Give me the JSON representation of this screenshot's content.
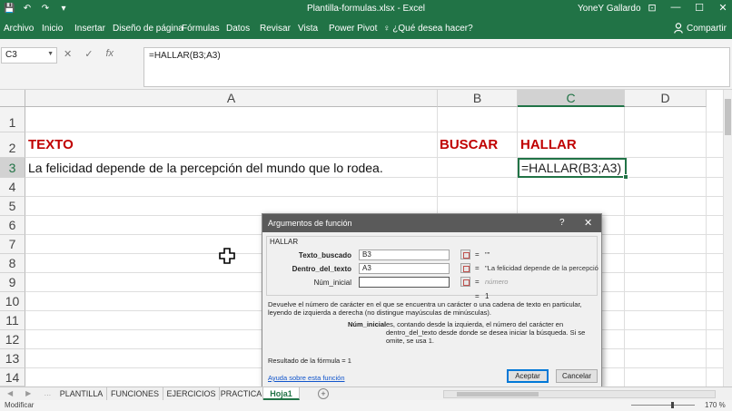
{
  "titlebar": {
    "qat": [
      "💾",
      "↶",
      "↷",
      "▾"
    ],
    "title": "Plantilla-formulas.xlsx  -  Excel",
    "user": "YoneY Gallardo",
    "window_buttons": [
      "⊡",
      "—",
      "☐",
      "✕"
    ]
  },
  "ribbon": {
    "tabs": [
      "Archivo",
      "Inicio",
      "Insertar",
      "Diseño de página",
      "Fórmulas",
      "Datos",
      "Revisar",
      "Vista",
      "Power Pivot"
    ],
    "tell_me": "♀ ¿Qué desea hacer?",
    "share": "Compartir"
  },
  "formula_bar": {
    "name_box": "C3",
    "cancel_icon": "✕",
    "enter_icon": "✓",
    "fx_icon": "fx",
    "formula": "=HALLAR(B3;A3)"
  },
  "grid": {
    "columns": [
      "A",
      "B",
      "C",
      "D"
    ],
    "rows": [
      "1",
      "2",
      "3",
      "4",
      "5",
      "6",
      "7",
      "8",
      "9",
      "10",
      "11",
      "12",
      "13",
      "14"
    ],
    "selected_column": "C",
    "selected_row": "3",
    "cells": {
      "A2": "TEXTO",
      "B2": "BUSCAR",
      "C2": "HALLAR",
      "A3": "La felicidad depende de la percepción del mundo que lo rodea.",
      "C3": "=HALLAR(B3;A3)"
    },
    "header_color": "#c00000"
  },
  "dialog": {
    "title": "Argumentos de función",
    "help": "?",
    "close": "✕",
    "function_name": "HALLAR",
    "args": [
      {
        "label": "Texto_buscado",
        "value": "B3",
        "eq": "=",
        "result": "\"\""
      },
      {
        "label": "Dentro_del_texto",
        "value": "A3",
        "eq": "=",
        "result": "\"La felicidad depende de la percepció"
      },
      {
        "label": "Núm_inicial",
        "value": "",
        "eq": "=",
        "result": "número"
      }
    ],
    "result_eq": "=",
    "result_val": "1",
    "description": "Devuelve el número de carácter en el que se encuentra un carácter o una cadena de texto en particular, leyendo de izquierda a derecha (no distingue mayúsculas de minúsculas).",
    "arg_name": "Núm_inicial",
    "arg_description": "es, contando desde la izquierda, el número del carácter en dentro_del_texto desde donde se desea iniciar la búsqueda. Si se omite, se usa 1.",
    "formula_result": "Resultado de la fórmula =   1",
    "help_link": "Ayuda sobre esta función",
    "ok": "Aceptar",
    "cancel": "Cancelar"
  },
  "sheets": {
    "tabs": [
      "PLANTILLA",
      "FUNCIONES",
      "EJERCICIOS",
      "PRACTICA",
      "Hoja1"
    ],
    "active": "Hoja1",
    "add": "+",
    "nav": [
      "◀",
      "▶",
      "…"
    ]
  },
  "status": {
    "mode": "Modificar",
    "zoom": "170 %"
  },
  "colors": {
    "accent": "#217346",
    "dialog_title": "#5a5a5a"
  }
}
